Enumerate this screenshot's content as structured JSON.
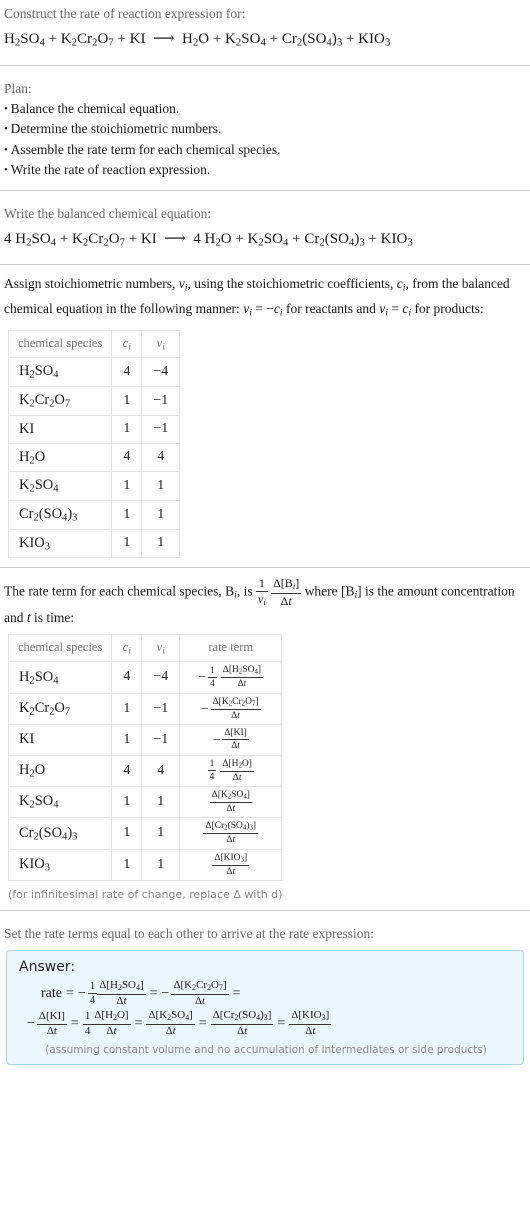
{
  "header": {
    "prompt": "Construct the rate of reaction expression for:",
    "equation_html": "H<sub>2</sub>SO<sub>4</sub> + K<sub>2</sub>Cr<sub>2</sub>O<sub>7</sub> + KI &nbsp;⟶&nbsp; H<sub>2</sub>O + K<sub>2</sub>SO<sub>4</sub> + Cr<sub>2</sub>(SO<sub>4</sub>)<sub>3</sub> + KIO<sub>3</sub>"
  },
  "plan": {
    "label": "Plan:",
    "steps": [
      "Balance the chemical equation.",
      "Determine the stoichiometric numbers.",
      "Assemble the rate term for each chemical species.",
      "Write the rate of reaction expression."
    ]
  },
  "balanced": {
    "label": "Write the balanced chemical equation:",
    "equation_html": "4 H<sub>2</sub>SO<sub>4</sub> + K<sub>2</sub>Cr<sub>2</sub>O<sub>7</sub> + KI &nbsp;⟶&nbsp; 4 H<sub>2</sub>O + K<sub>2</sub>SO<sub>4</sub> + Cr<sub>2</sub>(SO<sub>4</sub>)<sub>3</sub> + KIO<sub>3</sub>"
  },
  "stoich": {
    "paragraph_html": "Assign stoichiometric numbers, <span class=\"it\">v<sub>i</sub></span>, using the stoichiometric coefficients, <span class=\"it\">c<sub>i</sub></span>, from the balanced chemical equation in the following manner: <span class=\"it\">v<sub>i</sub></span> = −<span class=\"it\">c<sub>i</sub></span> for reactants and <span class=\"it\">v<sub>i</sub></span> = <span class=\"it\">c<sub>i</sub></span> for products:",
    "headers": [
      "chemical species",
      "c_i",
      "v_i"
    ],
    "header_html": [
      "chemical species",
      "<span class=\"it\">c<sub>i</sub></span>",
      "<span class=\"it\">v<sub>i</sub></span>"
    ],
    "rows": [
      {
        "species_html": "H<sub>2</sub>SO<sub>4</sub>",
        "c": "4",
        "v": "−4"
      },
      {
        "species_html": "K<sub>2</sub>Cr<sub>2</sub>O<sub>7</sub>",
        "c": "1",
        "v": "−1"
      },
      {
        "species_html": "KI",
        "c": "1",
        "v": "−1"
      },
      {
        "species_html": "H<sub>2</sub>O",
        "c": "4",
        "v": "4"
      },
      {
        "species_html": "K<sub>2</sub>SO<sub>4</sub>",
        "c": "1",
        "v": "1"
      },
      {
        "species_html": "Cr<sub>2</sub>(SO<sub>4</sub>)<sub>3</sub>",
        "c": "1",
        "v": "1"
      },
      {
        "species_html": "KIO<sub>3</sub>",
        "c": "1",
        "v": "1"
      }
    ]
  },
  "rateterm": {
    "paragraph_prefix": "The rate term for each chemical species, B",
    "paragraph_html": "The rate term for each chemical species, B<sub class=\"it\">i</sub>, is <span class=\"frac\" style=\"font-size:12px\"><span class=\"num-p\">1</span><span class=\"den-p it\">v<sub>i</sub></span></span> <span class=\"frac\" style=\"font-size:12px\"><span class=\"num-p\">Δ[B<sub class=\"it\">i</sub>]</span><span class=\"den-p\">Δ<span class=\"it\">t</span></span></span> where [B<sub class=\"it\">i</sub>] is the amount concentration and <span class=\"it\">t</span> is time:",
    "headers_html": [
      "chemical species",
      "<span class=\"it\">c<sub>i</sub></span>",
      "<span class=\"it\">v<sub>i</sub></span>",
      "rate term"
    ],
    "rows": [
      {
        "species_html": "H<sub>2</sub>SO<sub>4</sub>",
        "c": "4",
        "v": "−4",
        "rate_html": "<span class=\"rt\"><span class=\"minus\">−</span><span class=\"frac small\"><span class=\"num-p\">1</span><span class=\"den-p\">4</span></span><span class=\"gap\"></span><span class=\"frac small\"><span class=\"num-p\">Δ[H<sub>2</sub>SO<sub>4</sub>]</span><span class=\"den-p\">Δ<span class=\"it\">t</span></span></span></span>"
      },
      {
        "species_html": "K<sub>2</sub>Cr<sub>2</sub>O<sub>7</sub>",
        "c": "1",
        "v": "−1",
        "rate_html": "<span class=\"rt\"><span class=\"minus\">−</span><span class=\"frac small\"><span class=\"num-p\">Δ[K<sub>2</sub>Cr<sub>2</sub>O<sub>7</sub>]</span><span class=\"den-p\">Δ<span class=\"it\">t</span></span></span></span>"
      },
      {
        "species_html": "KI",
        "c": "1",
        "v": "−1",
        "rate_html": "<span class=\"rt\"><span class=\"minus\">−</span><span class=\"frac small\"><span class=\"num-p\">Δ[KI]</span><span class=\"den-p\">Δ<span class=\"it\">t</span></span></span></span>"
      },
      {
        "species_html": "H<sub>2</sub>O",
        "c": "4",
        "v": "4",
        "rate_html": "<span class=\"rt\"><span class=\"frac small\"><span class=\"num-p\">1</span><span class=\"den-p\">4</span></span><span class=\"gap\"></span><span class=\"frac small\"><span class=\"num-p\">Δ[H<sub>2</sub>O]</span><span class=\"den-p\">Δ<span class=\"it\">t</span></span></span></span>"
      },
      {
        "species_html": "K<sub>2</sub>SO<sub>4</sub>",
        "c": "1",
        "v": "1",
        "rate_html": "<span class=\"rt\"><span class=\"frac small\"><span class=\"num-p\">Δ[K<sub>2</sub>SO<sub>4</sub>]</span><span class=\"den-p\">Δ<span class=\"it\">t</span></span></span></span>"
      },
      {
        "species_html": "Cr<sub>2</sub>(SO<sub>4</sub>)<sub>3</sub>",
        "c": "1",
        "v": "1",
        "rate_html": "<span class=\"rt\"><span class=\"frac small\"><span class=\"num-p\">Δ[Cr<sub>2</sub>(SO<sub>4</sub>)<sub>3</sub>]</span><span class=\"den-p\">Δ<span class=\"it\">t</span></span></span></span>"
      },
      {
        "species_html": "KIO<sub>3</sub>",
        "c": "1",
        "v": "1",
        "rate_html": "<span class=\"rt\"><span class=\"frac small\"><span class=\"num-p\">Δ[KIO<sub>3</sub>]</span><span class=\"den-p\">Δ<span class=\"it\">t</span></span></span></span>"
      }
    ],
    "footnote": "(for infinitesimal rate of change, replace Δ with d)"
  },
  "final": {
    "label": "Set the rate terms equal to each other to arrive at the rate expression:",
    "answer_label": "Answer:",
    "expression_line1_html": "<span class=\"lbl-rate\">rate</span><span class=\"eq\">=</span><span class=\"minus\">−</span><span class=\"frac tiny\" style=\"font-size:11px\"><span class=\"num-p\">1</span><span class=\"den-p\">4</span></span><span class=\"gap\"></span><span class=\"frac small\" style=\"font-size:11px\"><span class=\"num-p\">Δ[H<sub>2</sub>SO<sub>4</sub>]</span><span class=\"den-p\">Δ<span class=\"it\">t</span></span></span><span class=\"eq\">=</span><span class=\"minus\">−</span><span class=\"frac small\" style=\"font-size:11px\"><span class=\"num-p\">Δ[K<sub>2</sub>Cr<sub>2</sub>O<sub>7</sub>]</span><span class=\"den-p\">Δ<span class=\"it\">t</span></span></span><span class=\"eq\">=</span>",
    "expression_line2_html": "<span class=\"minus\">−</span><span class=\"frac small\" style=\"font-size:11px\"><span class=\"num-p\">Δ[KI]</span><span class=\"den-p\">Δ<span class=\"it\">t</span></span></span><span class=\"eq\">=</span><span class=\"frac tiny\" style=\"font-size:11px\"><span class=\"num-p\">1</span><span class=\"den-p\">4</span></span><span class=\"gap\"></span><span class=\"frac small\" style=\"font-size:11px\"><span class=\"num-p\">Δ[H<sub>2</sub>O]</span><span class=\"den-p\">Δ<span class=\"it\">t</span></span></span><span class=\"eq\">=</span><span class=\"frac small\" style=\"font-size:11px\"><span class=\"num-p\">Δ[K<sub>2</sub>SO<sub>4</sub>]</span><span class=\"den-p\">Δ<span class=\"it\">t</span></span></span><span class=\"eq\">=</span><span class=\"frac small\" style=\"font-size:11px\"><span class=\"num-p\">Δ[Cr<sub>2</sub>(SO<sub>4</sub>)<sub>3</sub>]</span><span class=\"den-p\">Δ<span class=\"it\">t</span></span></span><span class=\"eq\">=</span><span class=\"frac small\" style=\"font-size:11px\"><span class=\"num-p\">Δ[KIO<sub>3</sub>]</span><span class=\"den-p\">Δ<span class=\"it\">t</span></span></span>",
    "assumption_note": "(assuming constant volume and no accumulation of intermediates or side products)"
  },
  "colors": {
    "answer_bg": "#eaf8fd",
    "answer_border": "#a8d8e8",
    "divider": "#cfcfcf",
    "muted_text": "#8a8a8a",
    "body_text": "#1a1a1a"
  }
}
